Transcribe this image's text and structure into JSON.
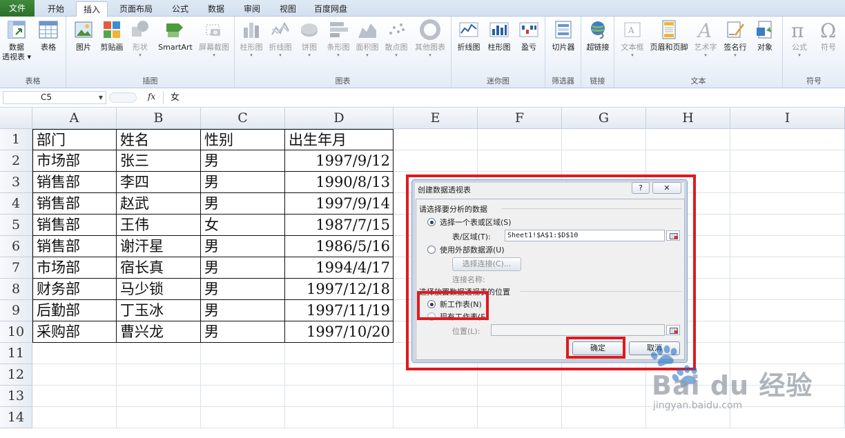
{
  "tabs": {
    "file": "文件",
    "items": [
      "开始",
      "插入",
      "页面布局",
      "公式",
      "数据",
      "审阅",
      "视图",
      "百度网盘"
    ],
    "active": "插入"
  },
  "ribbon": {
    "groups": [
      {
        "label": "表格",
        "buttons": [
          {
            "label": "数据\n透视表",
            "icon": "pivot-table-icon"
          },
          {
            "label": "表格",
            "icon": "table-icon"
          }
        ]
      },
      {
        "label": "插图",
        "buttons": [
          {
            "label": "图片",
            "icon": "picture-icon"
          },
          {
            "label": "剪贴画",
            "icon": "clipart-icon"
          },
          {
            "label": "形状",
            "icon": "shapes-icon"
          },
          {
            "label": "SmartArt",
            "icon": "smartart-icon"
          },
          {
            "label": "屏幕截图",
            "icon": "screenshot-icon"
          }
        ]
      },
      {
        "label": "图表",
        "buttons": [
          {
            "label": "柱形图",
            "icon": "column-chart-icon"
          },
          {
            "label": "折线图",
            "icon": "line-chart-icon"
          },
          {
            "label": "饼图",
            "icon": "pie-chart-icon"
          },
          {
            "label": "条形图",
            "icon": "bar-chart-icon"
          },
          {
            "label": "面积图",
            "icon": "area-chart-icon"
          },
          {
            "label": "散点图",
            "icon": "scatter-chart-icon"
          },
          {
            "label": "其他图表",
            "icon": "other-chart-icon"
          }
        ]
      },
      {
        "label": "迷你图",
        "buttons": [
          {
            "label": "折线图",
            "icon": "sparkline-line-icon"
          },
          {
            "label": "柱形图",
            "icon": "sparkline-column-icon"
          },
          {
            "label": "盈亏",
            "icon": "sparkline-winloss-icon"
          }
        ]
      },
      {
        "label": "筛选器",
        "buttons": [
          {
            "label": "切片器",
            "icon": "slicer-icon"
          }
        ]
      },
      {
        "label": "链接",
        "buttons": [
          {
            "label": "超链接",
            "icon": "hyperlink-icon"
          }
        ]
      },
      {
        "label": "文本",
        "buttons": [
          {
            "label": "文本框",
            "icon": "textbox-icon"
          },
          {
            "label": "页眉和页脚",
            "icon": "header-footer-icon"
          },
          {
            "label": "艺术字",
            "icon": "wordart-icon"
          },
          {
            "label": "签名行",
            "icon": "signature-icon"
          },
          {
            "label": "对象",
            "icon": "object-icon"
          }
        ]
      },
      {
        "label": "符号",
        "buttons": [
          {
            "label": "公式",
            "icon": "equation-icon"
          },
          {
            "label": "符号",
            "icon": "symbol-icon"
          }
        ]
      }
    ]
  },
  "formula_bar": {
    "name_box": "C5",
    "fx": "fx",
    "formula": "女"
  },
  "sheet": {
    "columns": [
      "A",
      "B",
      "C",
      "D",
      "E",
      "F",
      "G",
      "H",
      "I"
    ],
    "rows": [
      "1",
      "2",
      "3",
      "4",
      "5",
      "6",
      "7",
      "8",
      "9",
      "10",
      "11",
      "12",
      "13",
      "14"
    ],
    "table": [
      [
        "部门",
        "姓名",
        "性别",
        "出生年月"
      ],
      [
        "市场部",
        "张三",
        "男",
        "1997/9/12"
      ],
      [
        "销售部",
        "李四",
        "男",
        "1990/8/13"
      ],
      [
        "销售部",
        "赵武",
        "男",
        "1997/9/14"
      ],
      [
        "销售部",
        "王伟",
        "女",
        "1987/7/15"
      ],
      [
        "销售部",
        "谢汗星",
        "男",
        "1986/5/16"
      ],
      [
        "市场部",
        "宿长真",
        "男",
        "1994/4/17"
      ],
      [
        "财务部",
        "马少锁",
        "男",
        "1997/12/18"
      ],
      [
        "后勤部",
        "丁玉冰",
        "男",
        "1997/11/19"
      ],
      [
        "采购部",
        "曹兴龙",
        "男",
        "1997/10/20"
      ]
    ]
  },
  "dialog": {
    "title": "创建数据透视表",
    "help": "?",
    "close": "✕",
    "section1": "请选择要分析的数据",
    "opt_select_range": "选择一个表或区域(S)",
    "range_label": "表/区域(T):",
    "range_value": "Sheet1!$A$1:$D$10",
    "opt_external": "使用外部数据源(U)",
    "choose_connection": "选择连接(C)...",
    "connection_name": "连接名称:",
    "section2": "选择放置数据透视表的位置",
    "opt_new_sheet": "新工作表(N)",
    "opt_existing_sheet": "现有工作表(E)",
    "location_label": "位置(L):",
    "ok": "确定",
    "cancel": "取消"
  },
  "watermark": {
    "brand": "Bai du 经验",
    "sub": "jingyan.baidu.com"
  },
  "colors": {
    "highlight": "#e0191f",
    "file_tab": "#2c6f2a"
  }
}
